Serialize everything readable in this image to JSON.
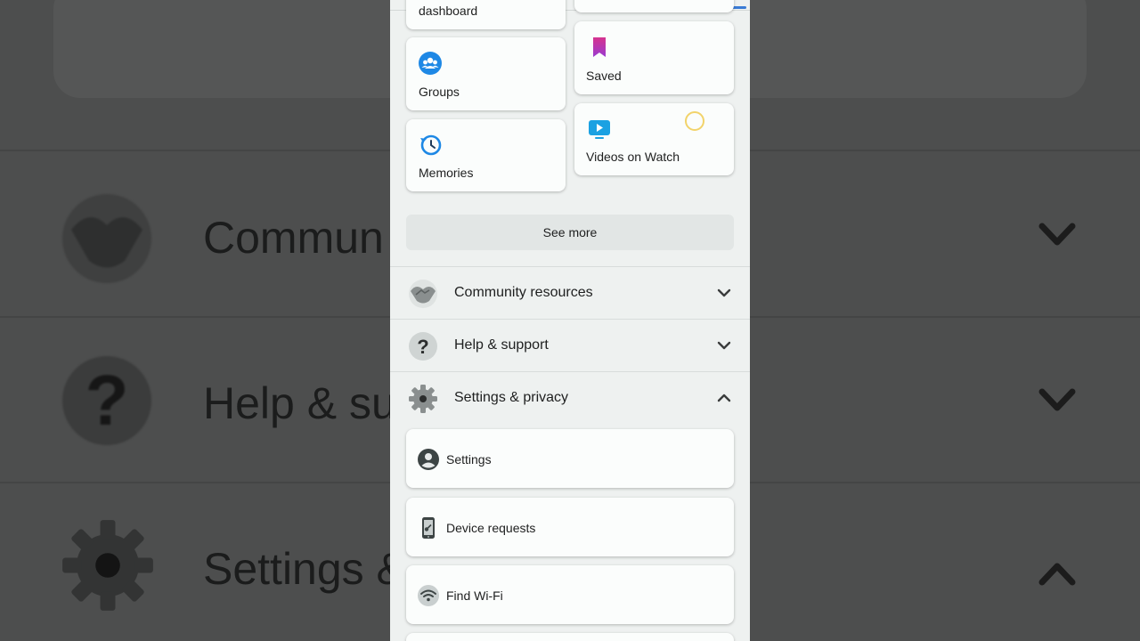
{
  "shortcuts": {
    "partial_top_label": "dashboard",
    "groups_label": "Groups",
    "saved_label": "Saved",
    "memories_label": "Memories",
    "videos_label": "Videos on Watch",
    "see_more_label": "See more"
  },
  "sections": {
    "community_label": "Community resources",
    "help_label": "Help & support",
    "settings_privacy_label": "Settings & privacy"
  },
  "settings_items": {
    "settings_label": "Settings",
    "device_requests_label": "Device requests",
    "find_wifi_label": "Find Wi-Fi"
  },
  "background": {
    "community_text": "Commun",
    "help_text": "Help & su",
    "settings_text": "Settings &",
    "help_glyph": "?"
  },
  "colors": {
    "accent_blue": "#3a7bd5",
    "saved_pink": "#c23fa0",
    "icon_blue": "#1e88e5"
  }
}
